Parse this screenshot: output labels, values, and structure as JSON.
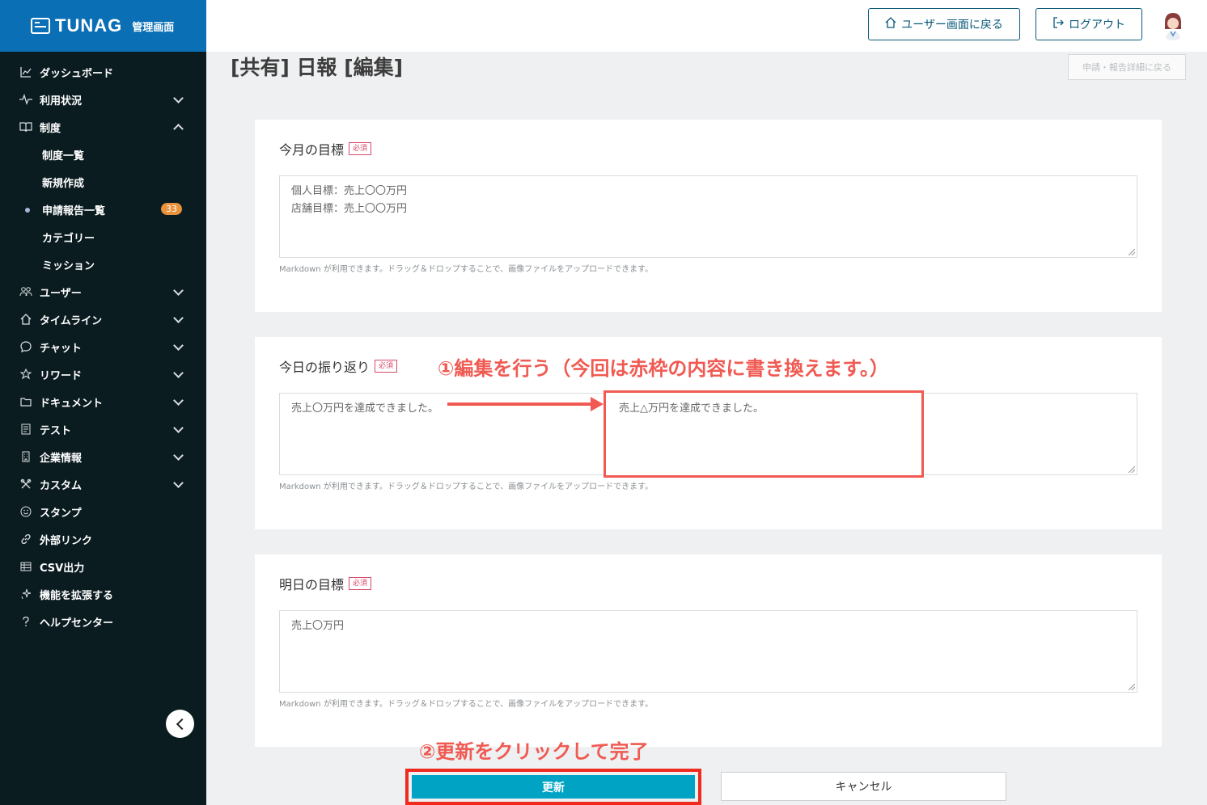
{
  "brand": {
    "name": "TUNAG",
    "sub": "管理画面"
  },
  "header": {
    "user_screen_label": "ユーザー画面に戻る",
    "logout_label": "ログアウト"
  },
  "sidebar": {
    "items": [
      {
        "label": "ダッシュボード",
        "icon": "chart-icon"
      },
      {
        "label": "利用状況",
        "icon": "pulse-icon"
      },
      {
        "label": "制度",
        "icon": "book-icon"
      },
      {
        "label": "ユーザー",
        "icon": "users-icon"
      },
      {
        "label": "タイムライン",
        "icon": "home-icon"
      },
      {
        "label": "チャット",
        "icon": "chat-icon"
      },
      {
        "label": "リワード",
        "icon": "star-icon"
      },
      {
        "label": "ドキュメント",
        "icon": "folder-icon"
      },
      {
        "label": "テスト",
        "icon": "list-icon"
      },
      {
        "label": "企業情報",
        "icon": "building-icon"
      },
      {
        "label": "カスタム",
        "icon": "tools-icon"
      },
      {
        "label": "スタンプ",
        "icon": "smile-icon"
      },
      {
        "label": "外部リンク",
        "icon": "link-icon"
      },
      {
        "label": "CSV出力",
        "icon": "table-icon"
      },
      {
        "label": "機能を拡張する",
        "icon": "sparkle-icon"
      },
      {
        "label": "ヘルプセンター",
        "icon": "question-icon"
      }
    ],
    "sub_items": [
      {
        "label": "制度一覧"
      },
      {
        "label": "新規作成"
      },
      {
        "label": "申請報告一覧",
        "badge": "33"
      },
      {
        "label": "カテゴリー"
      },
      {
        "label": "ミッション"
      }
    ]
  },
  "page": {
    "title": "[共有] 日報 [編集]",
    "back_label": "申請・報告詳細に戻る"
  },
  "form": {
    "required_label": "必須",
    "help_text": "Markdown が利用できます。ドラッグ＆ドロップすることで、画像ファイルをアップロードできます。",
    "fields": [
      {
        "label": "今月の目標",
        "value": "個人目標：売上〇〇万円\n店舗目標：売上〇〇万円"
      },
      {
        "label": "今日の振り返り",
        "value": "売上〇万円を達成できました。",
        "replacement": "売上△万円を達成できました。"
      },
      {
        "label": "明日の目標",
        "value": "売上〇万円"
      }
    ],
    "update_label": "更新",
    "cancel_label": "キャンセル"
  },
  "annotations": {
    "step1": "①編集を行う（今回は赤枠の内容に書き換えます。）",
    "step2": "②更新をクリックして完了"
  },
  "colors": {
    "brand_blue": "#0a6fb5",
    "sidebar_bg": "#0b1c21",
    "accent_teal": "#00a3c4",
    "annotation_red": "#f05a52"
  }
}
